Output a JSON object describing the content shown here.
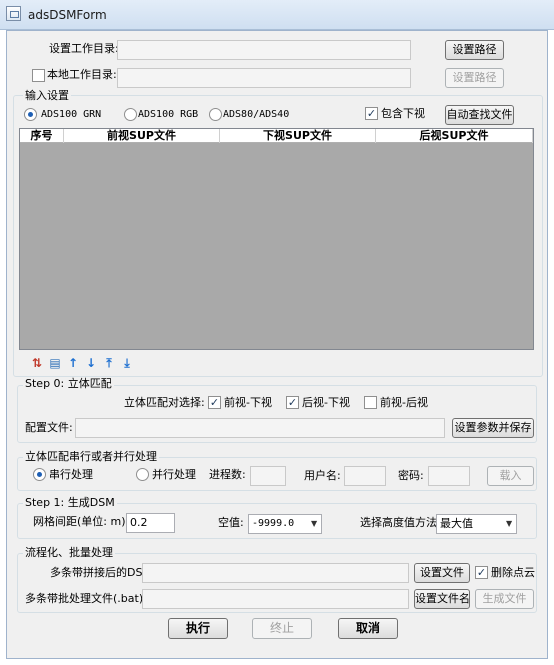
{
  "window": {
    "title": "adsDSMForm"
  },
  "work_dir": {
    "label": "设置工作目录:",
    "value": "",
    "button": "设置路径"
  },
  "local_dir": {
    "label": "本地工作目录:",
    "checked": false,
    "value": "",
    "button": "设置路径"
  },
  "input_settings": {
    "group_label": "输入设置",
    "radios": [
      "ADS100 GRN",
      "ADS100 RGB",
      "ADS80/ADS40"
    ],
    "include_nadir": {
      "label": "包含下视",
      "checked": true
    },
    "auto_find_button": "自动查找文件"
  },
  "grid": {
    "columns": [
      "序号",
      "前视SUP文件",
      "下视SUP文件",
      "后视SUP文件"
    ]
  },
  "toolbar": {
    "icons": [
      "sort-icon",
      "import-icon",
      "move-up-icon",
      "move-down-icon",
      "move-top-icon",
      "move-bottom-icon"
    ]
  },
  "step0": {
    "group_label": "Step 0: 立体匹配",
    "pair_label": "立体匹配对选择:",
    "pairs": [
      {
        "label": "前视-下视",
        "checked": true
      },
      {
        "label": "后视-下视",
        "checked": true
      },
      {
        "label": "前视-后视",
        "checked": false
      }
    ],
    "config_label": "配置文件:",
    "config_value": "",
    "config_button": "设置参数并保存"
  },
  "parallel": {
    "group_label": "立体匹配串行或者并行处理",
    "serial_label": "串行处理",
    "parallel_label": "并行处理",
    "process_label": "进程数:",
    "user_label": "用户名:",
    "password_label": "密码:",
    "load_button": "载入"
  },
  "step1": {
    "group_label": "Step 1: 生成DSM",
    "grid_spacing_label": "网格间距(单位: m):",
    "grid_spacing_value": "0.2",
    "nodata_label": "空值:",
    "nodata_value": "-9999.0",
    "height_method_label": "选择高度值方法:",
    "height_method_value": "最大值"
  },
  "batch": {
    "group_label": "流程化、批量处理",
    "merged_dsm_label": "多条带拼接后的DSM:",
    "merged_dsm_value": "",
    "set_file_button": "设置文件",
    "delete_pointcloud": {
      "label": "删除点云",
      "checked": true
    },
    "bat_label": "多条带批处理文件(.bat):",
    "bat_value": "",
    "set_filename_button": "设置文件名",
    "generate_button": "生成文件"
  },
  "actions": {
    "run": "执行",
    "stop": "终止",
    "cancel": "取消"
  },
  "colors": {
    "grid_background": "#a9a9a9",
    "title_bar": "#dce8f5",
    "radio_dot": "#1e5fb4"
  }
}
